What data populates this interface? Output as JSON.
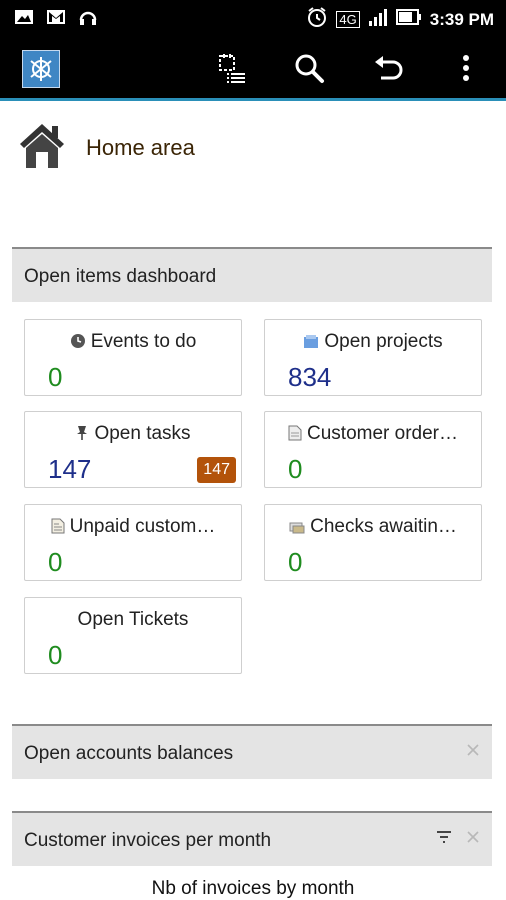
{
  "status_bar": {
    "time": "3:39 PM",
    "network": "4G"
  },
  "toolbar": {
    "app_logo": "app-logo-icon",
    "actions": [
      "calendar-list-icon",
      "search-icon",
      "undo-icon",
      "overflow-menu-icon"
    ]
  },
  "home": {
    "title": "Home area"
  },
  "dashboard": {
    "title": "Open items dashboard",
    "cards": [
      {
        "label": "Events to do",
        "value": "0",
        "icon": "clock-icon"
      },
      {
        "label": "Open projects",
        "value": "834",
        "icon": "projects-icon"
      },
      {
        "label": "Open tasks",
        "value": "147",
        "icon": "pin-icon",
        "badge": "147"
      },
      {
        "label": "Customer order…",
        "value": "0",
        "icon": "document-icon"
      },
      {
        "label": "Unpaid custom…",
        "value": "0",
        "icon": "invoice-icon"
      },
      {
        "label": "Checks awaitin…",
        "value": "0",
        "icon": "checks-icon"
      },
      {
        "label": "Open Tickets",
        "value": "0"
      }
    ]
  },
  "sections": {
    "balances_title": "Open accounts balances",
    "invoices_title": "Customer invoices per month",
    "invoices_chart_caption": "Nb of invoices by month"
  },
  "colors": {
    "accent": "#2a8fb8",
    "value_green": "#1f8c1f",
    "value_blue": "#1e2f8a",
    "badge": "#b3530a"
  }
}
